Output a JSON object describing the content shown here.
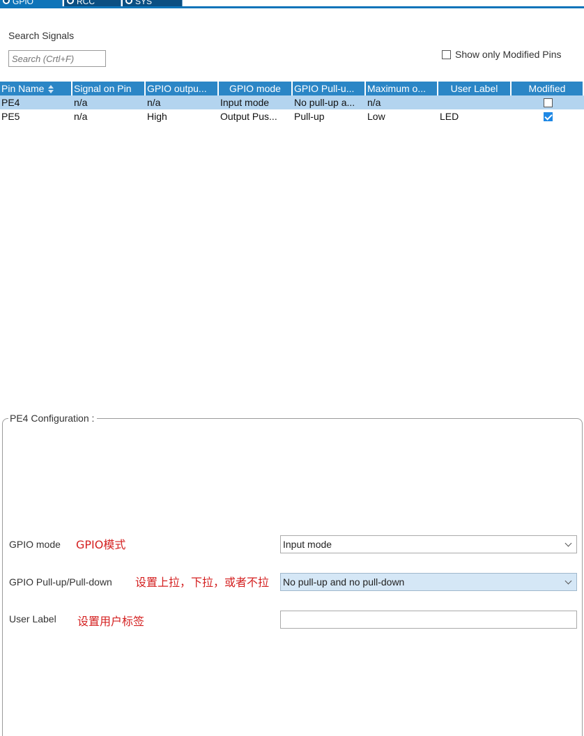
{
  "tabs": [
    {
      "label": "GPIO"
    },
    {
      "label": "RCC"
    },
    {
      "label": "SYS"
    }
  ],
  "search": {
    "title": "Search Signals",
    "placeholder": "Search (Crtl+F)",
    "value": ""
  },
  "filter": {
    "show_modified_label": "Show only Modified Pins",
    "checked": false
  },
  "table": {
    "headers": [
      "Pin Name",
      "Signal on Pin",
      "GPIO outpu...",
      "GPIO mode",
      "GPIO Pull-u...",
      "Maximum o...",
      "User Label",
      "Modified"
    ],
    "rows": [
      {
        "pin": "PE4",
        "signal": "n/a",
        "output": "n/a",
        "mode": "Input mode",
        "pull": "No pull-up a...",
        "speed": "n/a",
        "label": "",
        "modified": false,
        "selected": true
      },
      {
        "pin": "PE5",
        "signal": "n/a",
        "output": "High",
        "mode": "Output Pus...",
        "pull": "Pull-up",
        "speed": "Low",
        "label": "LED",
        "modified": true,
        "selected": false
      }
    ]
  },
  "config": {
    "title": "PE4 Configuration :",
    "gpio_mode": {
      "label": "GPIO mode",
      "annotation": "GPIO模式",
      "value": "Input mode"
    },
    "pull": {
      "label": "GPIO Pull-up/Pull-down",
      "annotation": "设置上拉，下拉，或者不拉",
      "value": "No pull-up and no pull-down"
    },
    "user_label": {
      "label": "User Label",
      "annotation": "设置用户标签",
      "value": ""
    }
  },
  "colors": {
    "header_bg": "#2b86c6",
    "selected_row": "#b3d4ef",
    "annotation": "#d42020",
    "tab_bg": "#0b4f82"
  }
}
